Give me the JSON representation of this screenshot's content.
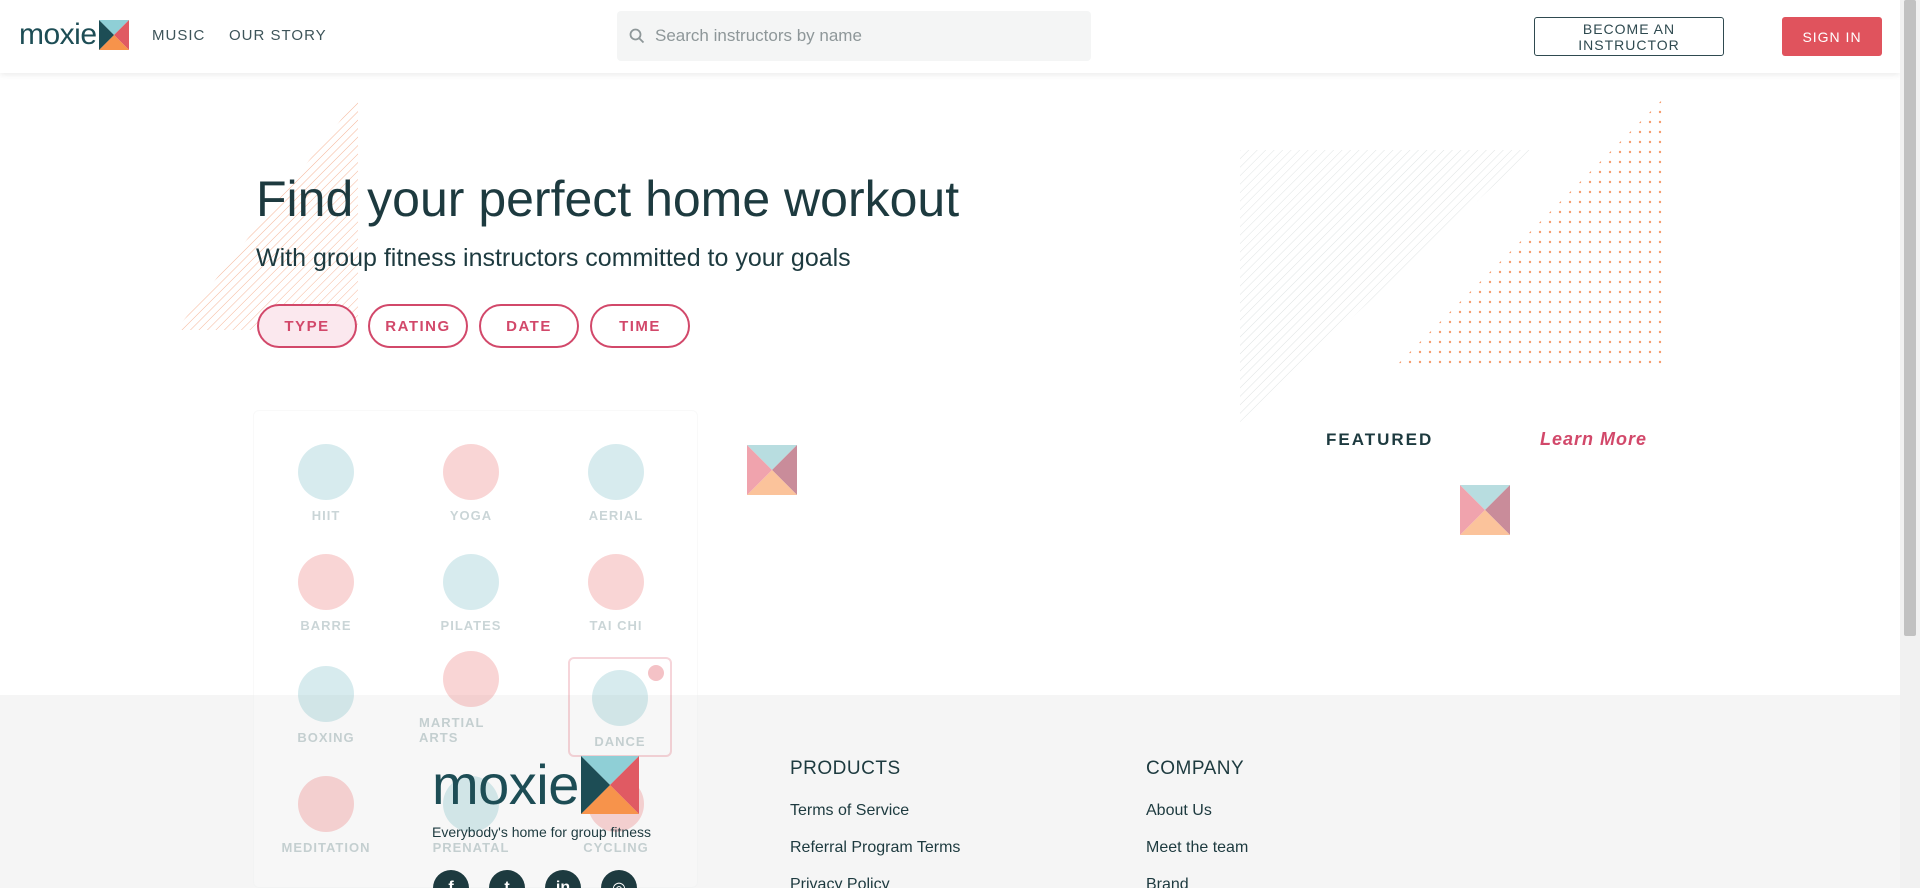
{
  "header": {
    "logo": "moxie",
    "nav": [
      {
        "label": "MUSIC"
      },
      {
        "label": "OUR STORY"
      }
    ],
    "search_placeholder": "Search instructors by name",
    "become_instructor": "BECOME AN INSTRUCTOR",
    "sign_in": "SIGN IN"
  },
  "hero": {
    "title": "Find your perfect home workout",
    "subtitle": "With group fitness instructors committed to your goals",
    "filters": [
      "TYPE",
      "RATING",
      "DATE",
      "TIME"
    ]
  },
  "types": [
    {
      "label": "HIIT",
      "color": "#8fc8d0"
    },
    {
      "label": "YOGA",
      "color": "#f08a8a"
    },
    {
      "label": "AERIAL",
      "color": "#8fc8d0"
    },
    {
      "label": "BARRE",
      "color": "#f08a8a"
    },
    {
      "label": "PILATES",
      "color": "#8fc8d0"
    },
    {
      "label": "TAI CHI",
      "color": "#f08a8a"
    },
    {
      "label": "BOXING",
      "color": "#8fc8d0"
    },
    {
      "label": "MARTIAL ARTS",
      "color": "#f08a8a"
    },
    {
      "label": "DANCE",
      "color": "#8fc8d0",
      "selected": true
    },
    {
      "label": "MEDITATION",
      "color": "#f08a8a"
    },
    {
      "label": "PRENATAL",
      "color": "#8fc8d0"
    },
    {
      "label": "CYCLING",
      "color": "#f08a8a"
    }
  ],
  "featured": {
    "label": "FEATURED",
    "learn_more": "Learn More"
  },
  "footer": {
    "logo": "moxie",
    "tagline": "Everybody's home for group fitness",
    "socials": [
      "facebook-icon",
      "twitter-icon",
      "linkedin-icon",
      "instagram-icon"
    ],
    "products": {
      "heading": "PRODUCTS",
      "links": [
        "Terms of Service",
        "Referral Program Terms",
        "Privacy Policy"
      ]
    },
    "company": {
      "heading": "COMPANY",
      "links": [
        "About Us",
        "Meet the team",
        "Brand"
      ]
    }
  },
  "colors": {
    "brand_teal": "#1d4d55",
    "accent_red": "#e0535d",
    "accent_pink": "#d2486a",
    "footer_bg": "#f5f5f5"
  }
}
